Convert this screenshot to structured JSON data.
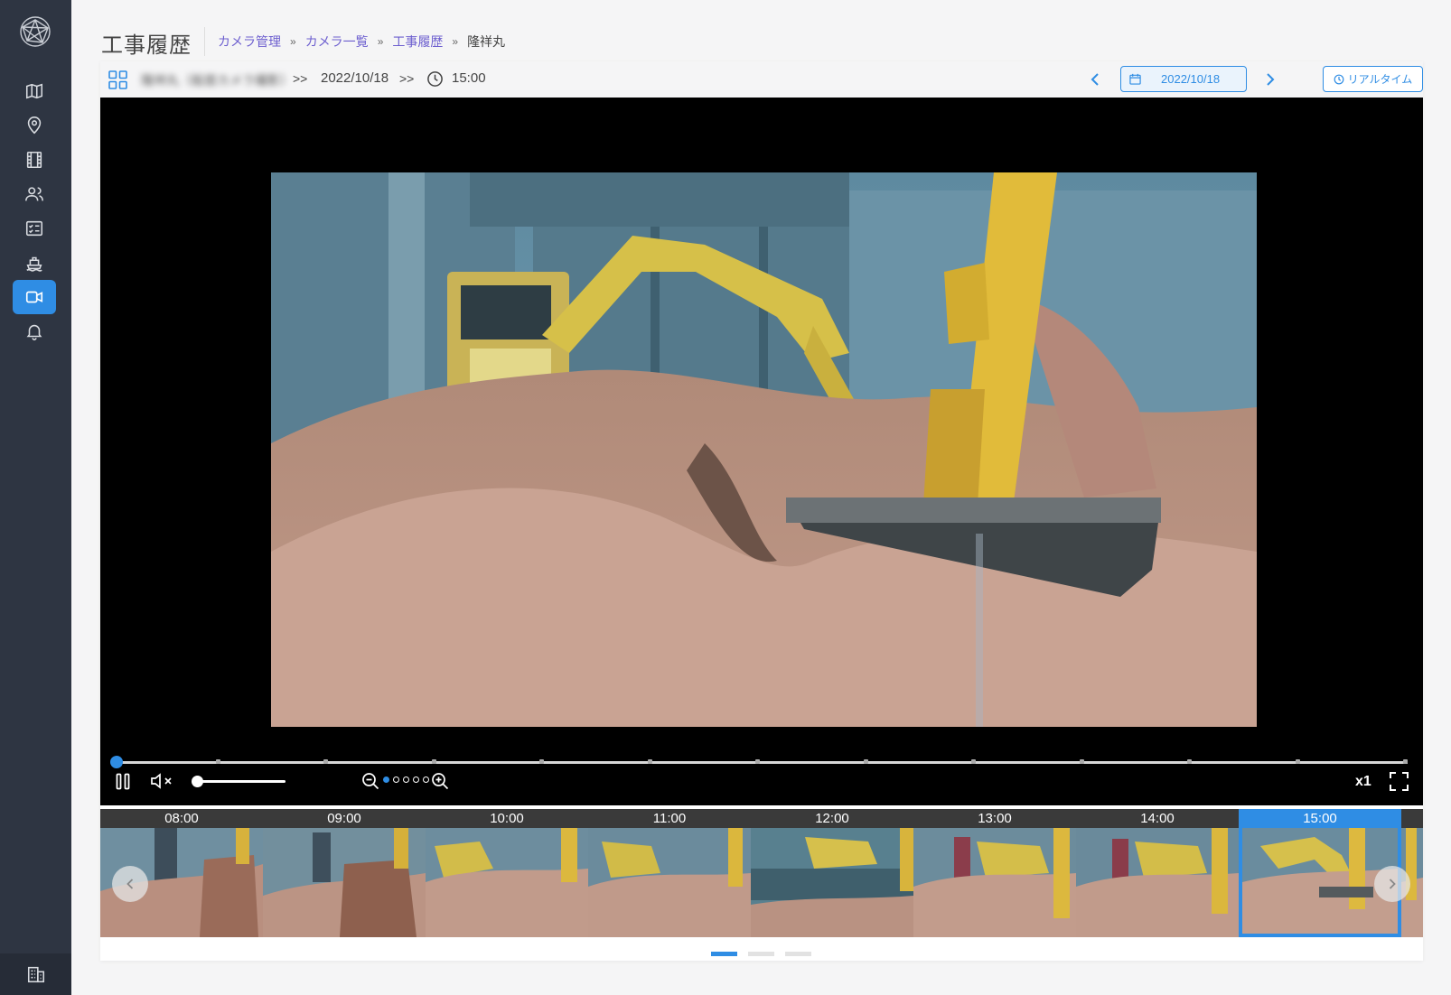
{
  "app": {
    "page_title": "工事履歴",
    "breadcrumb": [
      {
        "label": "カメラ管理"
      },
      {
        "label": "カメラ一覧"
      },
      {
        "label": "工事履歴"
      },
      {
        "label": "隆祥丸"
      }
    ],
    "breadcrumb_separator": "»"
  },
  "sidebar": {
    "items": [
      {
        "icon": "map-icon"
      },
      {
        "icon": "location-pin-icon"
      },
      {
        "icon": "film-icon"
      },
      {
        "icon": "users-icon"
      },
      {
        "icon": "checklist-icon"
      },
      {
        "icon": "ship-icon"
      },
      {
        "icon": "video-camera-icon",
        "active": true
      },
      {
        "icon": "bell-icon"
      }
    ],
    "bottom_icon": "building-icon"
  },
  "toolbar": {
    "camera_name": "隆祥丸（船首カメラ撮影）",
    "separator": ">>",
    "date": "2022/10/18",
    "time": "15:00",
    "date_picker_value": "2022/10/18",
    "realtime_label": "リアルタイム"
  },
  "player": {
    "speed_label": "x1",
    "volume_level": 0.0,
    "zoom_level_index": 0,
    "zoom_levels": 5,
    "playback_position": 0.0,
    "muted": true,
    "playing": true
  },
  "timeline": {
    "thumbnails": [
      {
        "time": "08:00"
      },
      {
        "time": "09:00"
      },
      {
        "time": "10:00"
      },
      {
        "time": "11:00"
      },
      {
        "time": "12:00"
      },
      {
        "time": "13:00"
      },
      {
        "time": "14:00"
      },
      {
        "time": "15:00",
        "selected": true
      }
    ],
    "pages": 3,
    "current_page": 1
  },
  "colors": {
    "accent": "#2f8de4",
    "sidebar_bg": "#2e3542",
    "breadcrumb_link": "#6d5fcf"
  }
}
